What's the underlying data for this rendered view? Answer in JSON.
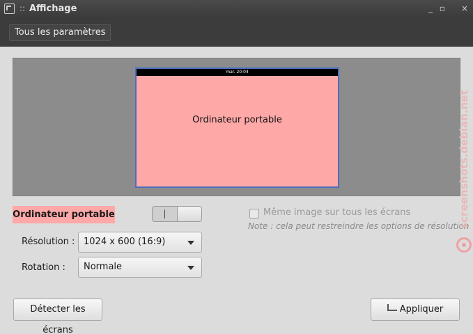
{
  "window": {
    "separator": "::",
    "title": "Affichage",
    "controls": {
      "minimize": "_",
      "maximize": "▫",
      "close": "×"
    }
  },
  "toolbar": {
    "all_settings_label": "Tous les paramètres"
  },
  "preview": {
    "topbar_clock": "mar. 20:04",
    "screen_label": "Ordinateur portable"
  },
  "output": {
    "name": "Ordinateur portable",
    "switch_on_glyph": "|",
    "mirror_label": "Même image sur tous les écrans",
    "note": "Note : cela peut restreindre les options de résolution",
    "resolution_label": "Résolution :",
    "resolution_value": "1024 x 600 (16:9)",
    "rotation_label": "Rotation :",
    "rotation_value": "Normale"
  },
  "buttons": {
    "detect_label": "Détecter les écrans",
    "apply_label": "Appliquer"
  },
  "watermark": {
    "text": "screenshots.debian.net"
  },
  "colors": {
    "screen_fill": "#ffa8a8",
    "preview_bg": "#8c8c8c",
    "titlebar": "#3c3c3c",
    "screen_border": "#4a6fbf"
  },
  "icons": [
    "app-icon",
    "minimize-icon",
    "maximize-icon",
    "close-icon",
    "chevron-down-icon",
    "apply-icon",
    "debian-logo-icon"
  ]
}
